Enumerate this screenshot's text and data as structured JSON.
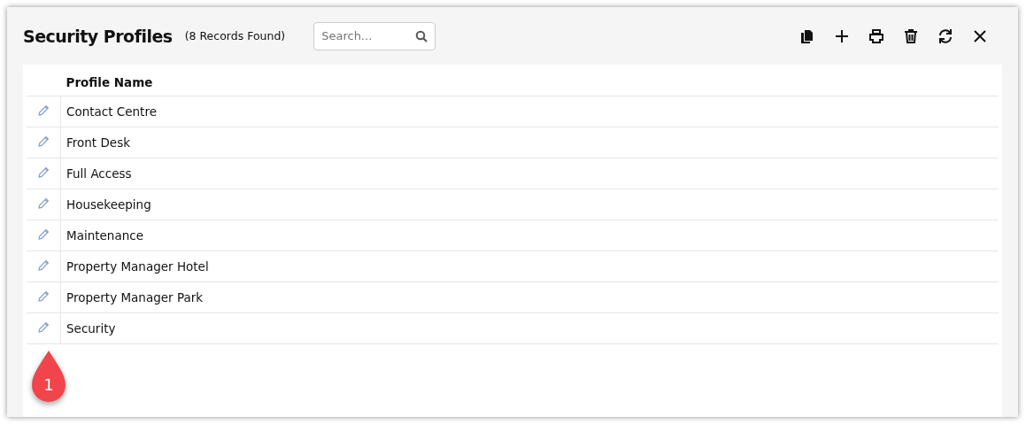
{
  "window": {
    "title": "Security Profiles",
    "record_count": "(8 Records Found)"
  },
  "search": {
    "placeholder": "Search..."
  },
  "toolbar": [
    {
      "kind": "copy"
    },
    {
      "kind": "add"
    },
    {
      "kind": "print"
    },
    {
      "kind": "delete"
    },
    {
      "kind": "refresh"
    },
    {
      "kind": "close"
    }
  ],
  "table": {
    "columns": [
      "Profile Name"
    ],
    "rows": [
      {
        "name": "Contact Centre"
      },
      {
        "name": "Front Desk"
      },
      {
        "name": "Full Access"
      },
      {
        "name": "Housekeeping"
      },
      {
        "name": "Maintenance"
      },
      {
        "name": "Property Manager Hotel"
      },
      {
        "name": "Property Manager Park"
      },
      {
        "name": "Security"
      }
    ]
  },
  "callout": {
    "label": "1"
  }
}
